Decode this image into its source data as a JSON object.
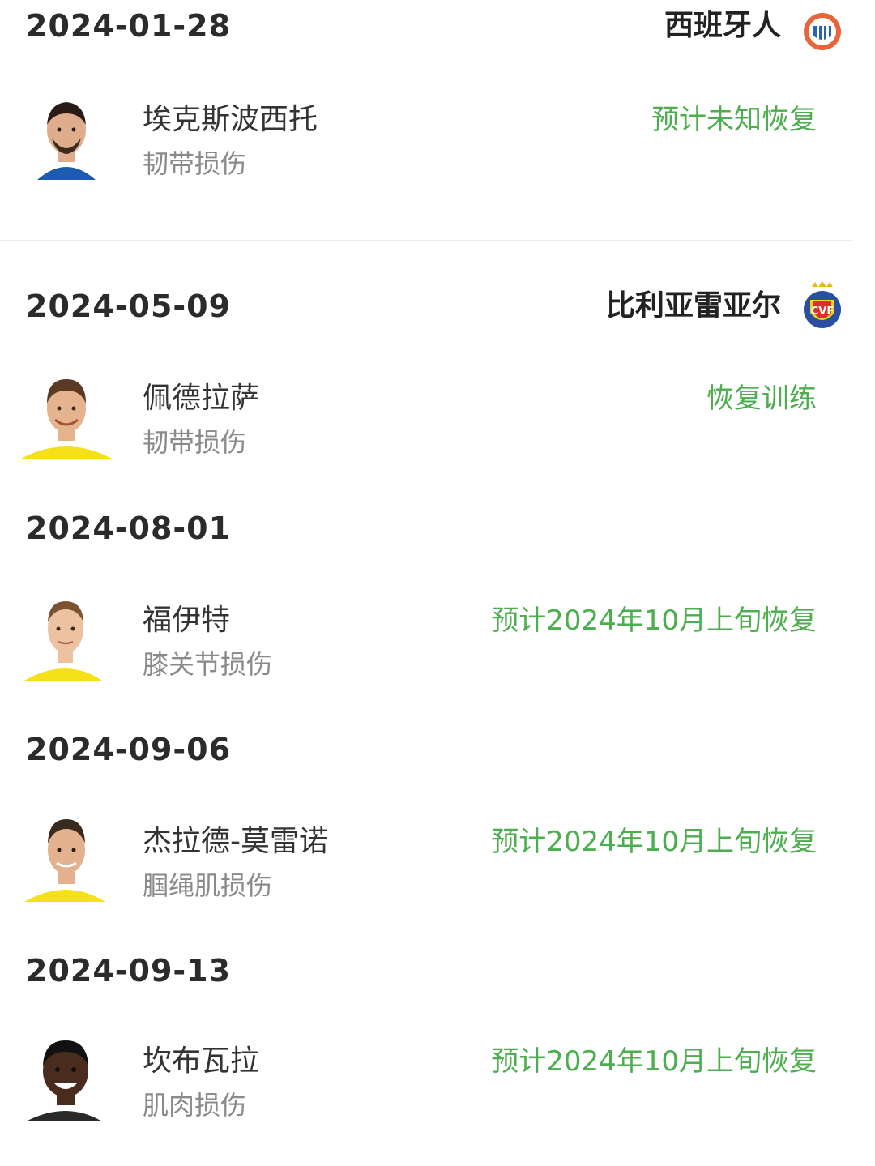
{
  "entries": [
    {
      "date": "2024-01-28",
      "team": "西班牙人",
      "team_crest_icon": "espanyol-crest-icon",
      "player": {
        "name": "埃克斯波西托",
        "injury": "韧带损伤",
        "status": "预计未知恢复",
        "kit_color": "#1c5bb0",
        "skin": "#e0ad8c",
        "hair": "#2a1c14"
      }
    },
    {
      "date": "2024-05-09",
      "team": "比利亚雷亚尔",
      "team_crest_icon": "villarreal-crest-icon",
      "player": {
        "name": "佩德拉萨",
        "injury": "韧带损伤",
        "status": "恢复训练",
        "kit_color": "#f5e11a",
        "skin": "#e6b38f",
        "hair": "#5a3a22"
      }
    },
    {
      "date": "2024-08-01",
      "team": "",
      "player": {
        "name": "福伊特",
        "injury": "膝关节损伤",
        "status": "预计2024年10月上旬恢复",
        "kit_color": "#f5e11a",
        "skin": "#edc2a0",
        "hair": "#7a5430"
      }
    },
    {
      "date": "2024-09-06",
      "team": "",
      "player": {
        "name": "杰拉德-莫雷诺",
        "injury": "腘绳肌损伤",
        "status": "预计2024年10月上旬恢复",
        "kit_color": "#f5e11a",
        "skin": "#e4b18e",
        "hair": "#3a2a1e"
      }
    },
    {
      "date": "2024-09-13",
      "team": "",
      "player": {
        "name": "坎布瓦拉",
        "injury": "肌肉损伤",
        "status": "预计2024年10月上旬恢复",
        "kit_color": "#2a2a2a",
        "skin": "#4a2c1e",
        "hair": "#111111"
      }
    }
  ],
  "colors": {
    "status_green": "#4cae4f",
    "date_text": "#2b2b2b",
    "injury_text": "#8a8a8a"
  }
}
